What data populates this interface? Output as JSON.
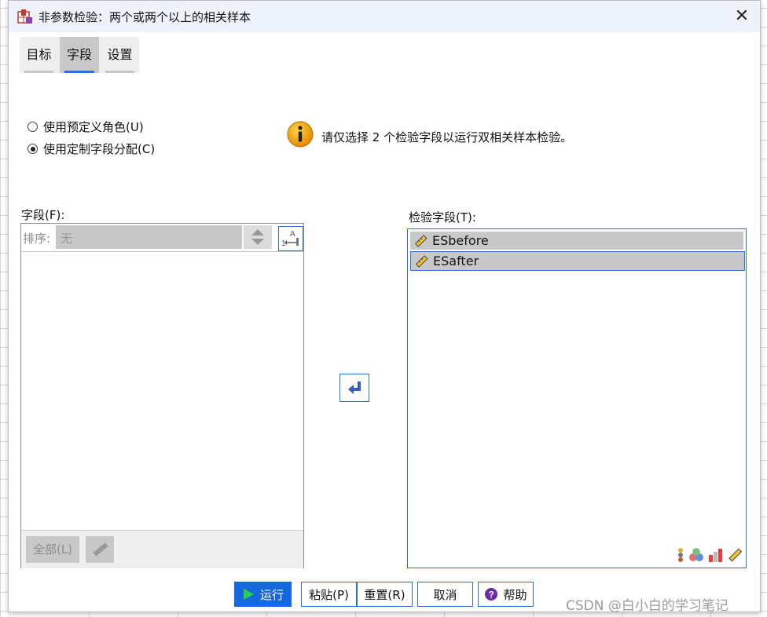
{
  "window": {
    "title": "非参数检验：两个或两个以上的相关样本",
    "close_label": "✕"
  },
  "tabs": [
    {
      "label": "目标",
      "active": false
    },
    {
      "label": "字段",
      "active": true
    },
    {
      "label": "设置",
      "active": false
    }
  ],
  "roles": {
    "option_predefined": "使用预定义角色(U)",
    "option_custom": "使用定制字段分配(C)",
    "selected": "custom"
  },
  "info": {
    "icon": "info-icon",
    "message": "请仅选择 2 个检验字段以运行双相关样本检验。"
  },
  "fields_panel": {
    "label": "字段(F):",
    "sort_label": "排序:",
    "sort_value": "无",
    "all_button": "全部(L)"
  },
  "test_fields": {
    "label": "检验字段(T):",
    "items": [
      {
        "name": "ESbefore",
        "icon": "scale-ruler-icon",
        "selected": false
      },
      {
        "name": "ESafter",
        "icon": "scale-ruler-icon",
        "selected": true
      }
    ]
  },
  "buttons": {
    "run": "运行",
    "paste": "粘贴(P)",
    "reset": "重置(R)",
    "cancel": "取消",
    "help": "帮助"
  },
  "colors": {
    "accent": "#2d6fd6",
    "primary_button": "#1668dd",
    "selection_gray": "#c8c8c8"
  },
  "watermark": "CSDN @白小白的学习笔记"
}
